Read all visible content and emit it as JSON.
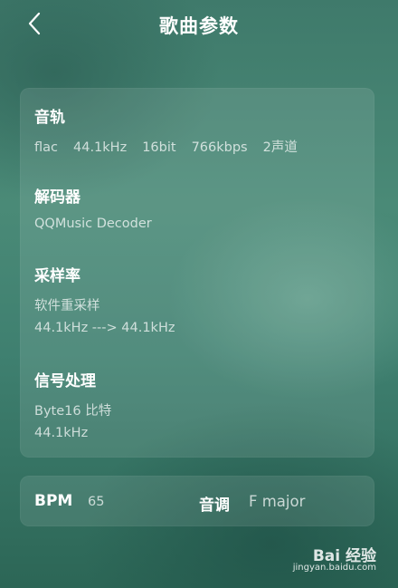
{
  "header": {
    "title": "歌曲参数",
    "back_icon": "chevron-left-icon"
  },
  "track": {
    "title": "音轨",
    "items": [
      "flac",
      "44.1kHz",
      "16bit",
      "766kbps",
      "2声道"
    ]
  },
  "decoder": {
    "title": "解码器",
    "value": "QQMusic Decoder"
  },
  "sample_rate": {
    "title": "采样率",
    "line1": "软件重采样",
    "line2": "44.1kHz ---> 44.1kHz"
  },
  "signal": {
    "title": "信号处理",
    "line1": "Byte16 比特",
    "line2": "44.1kHz"
  },
  "bpm": {
    "label": "BPM",
    "value": "65"
  },
  "key": {
    "label": "音调",
    "value": "F major"
  },
  "watermark": {
    "logo": "Bai 经验",
    "url": "jingyan.baidu.com"
  },
  "colors": {
    "background": "#458572",
    "card": "rgba(255,255,255,0.10)",
    "text": "#ffffff",
    "muted_text": "rgba(255,255,255,0.72)"
  }
}
